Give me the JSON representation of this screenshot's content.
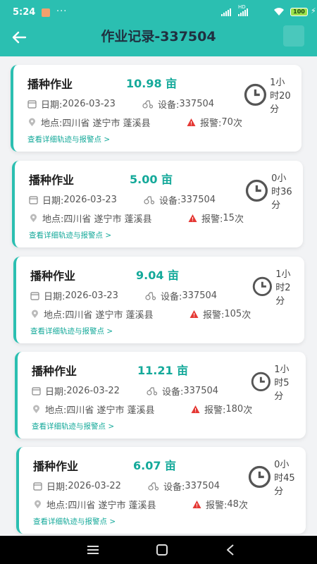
{
  "status_bar": {
    "time": "5:24",
    "more": "···",
    "net_label": "HD",
    "battery": "100"
  },
  "header": {
    "title": "作业记录-337504"
  },
  "labels": {
    "date_prefix": "日期: ",
    "device_prefix": "设备: ",
    "location_prefix": "地点: ",
    "alarm_prefix": "报警: ",
    "alarm_suffix": " 次"
  },
  "records": [
    {
      "type": "播种作业",
      "area": "10.98 亩",
      "duration": "1小时20分",
      "date": "2026-03-23",
      "device": "337504",
      "location": "四川省 遂宁市 蓬溪县",
      "alarms": "70",
      "link": "查看详细轨迹与报警点 >"
    },
    {
      "type": "播种作业",
      "area": "5.00 亩",
      "duration": "0小时36分",
      "date": "2026-03-23",
      "device": "337504",
      "location": "四川省 遂宁市 蓬溪县",
      "alarms": "15",
      "link": "查看详细轨迹与报警点 >"
    },
    {
      "type": "播种作业",
      "area": "9.04 亩",
      "duration": "1小时2分",
      "date": "2026-03-23",
      "device": "337504",
      "location": "四川省 遂宁市 蓬溪县",
      "alarms": "105",
      "link": "查看详细轨迹与报警点 >"
    },
    {
      "type": "播种作业",
      "area": "11.21 亩",
      "duration": "1小时5分",
      "date": "2026-03-22",
      "device": "337504",
      "location": "四川省 遂宁市 蓬溪县",
      "alarms": "180",
      "link": "查看详细轨迹与报警点 >"
    },
    {
      "type": "播种作业",
      "area": "6.07 亩",
      "duration": "0小时45分",
      "date": "2026-03-22",
      "device": "337504",
      "location": "四川省 遂宁市 蓬溪县",
      "alarms": "48",
      "link": "查看详细轨迹与报警点 >"
    }
  ],
  "colors": {
    "header": "#2bbfb1",
    "accent": "#14a99a",
    "alert": "#e53935"
  },
  "nav": {
    "icons": [
      "menu-icon",
      "home-square-icon",
      "back-triangle-icon"
    ]
  }
}
